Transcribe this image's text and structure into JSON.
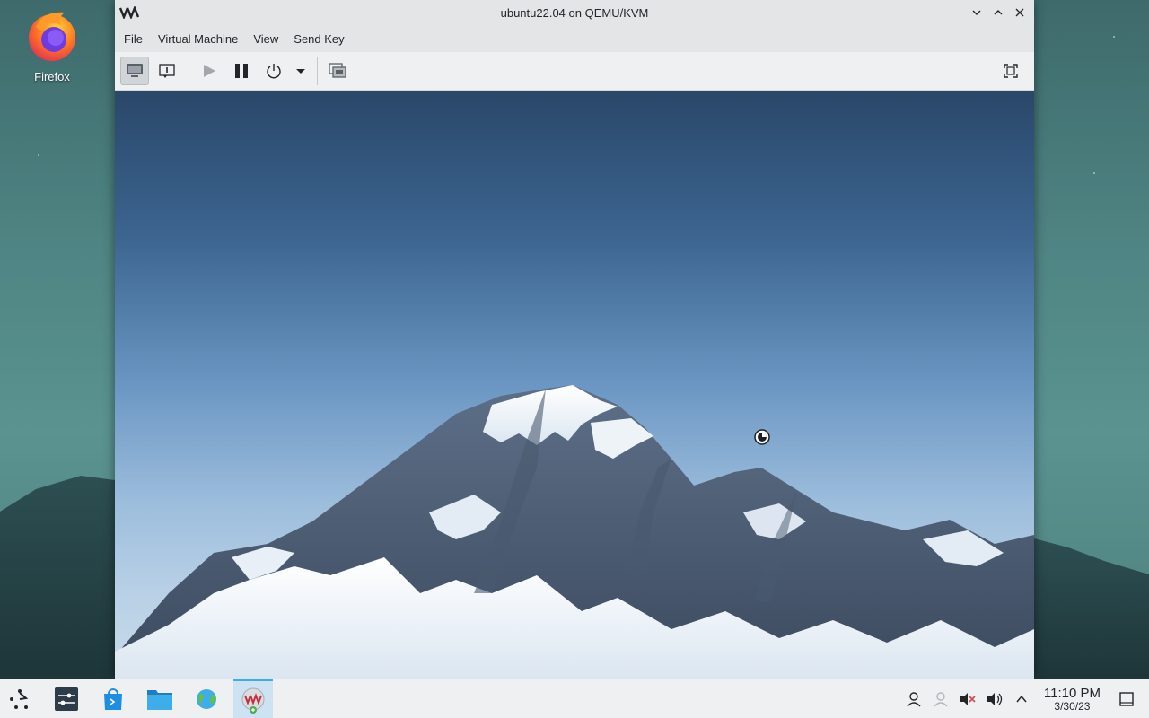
{
  "desktop": {
    "icons": [
      {
        "label": "Firefox",
        "icon": "firefox-icon"
      }
    ]
  },
  "window": {
    "title": "ubuntu22.04 on QEMU/KVM",
    "menu": [
      "File",
      "Virtual Machine",
      "View",
      "Send Key"
    ],
    "toolbar": {
      "buttons": [
        "console-view",
        "details-view",
        "run",
        "pause",
        "shutdown",
        "shutdown-menu",
        "snapshots",
        "fullscreen"
      ]
    }
  },
  "taskbar": {
    "apps": [
      "app-launcher",
      "settings",
      "discover",
      "files",
      "browser",
      "virt-manager"
    ]
  },
  "clock": {
    "time": "11:10 PM",
    "date": "3/30/23"
  },
  "colors": {
    "accent": "#3daee9",
    "window_bg": "#eff0f1"
  }
}
